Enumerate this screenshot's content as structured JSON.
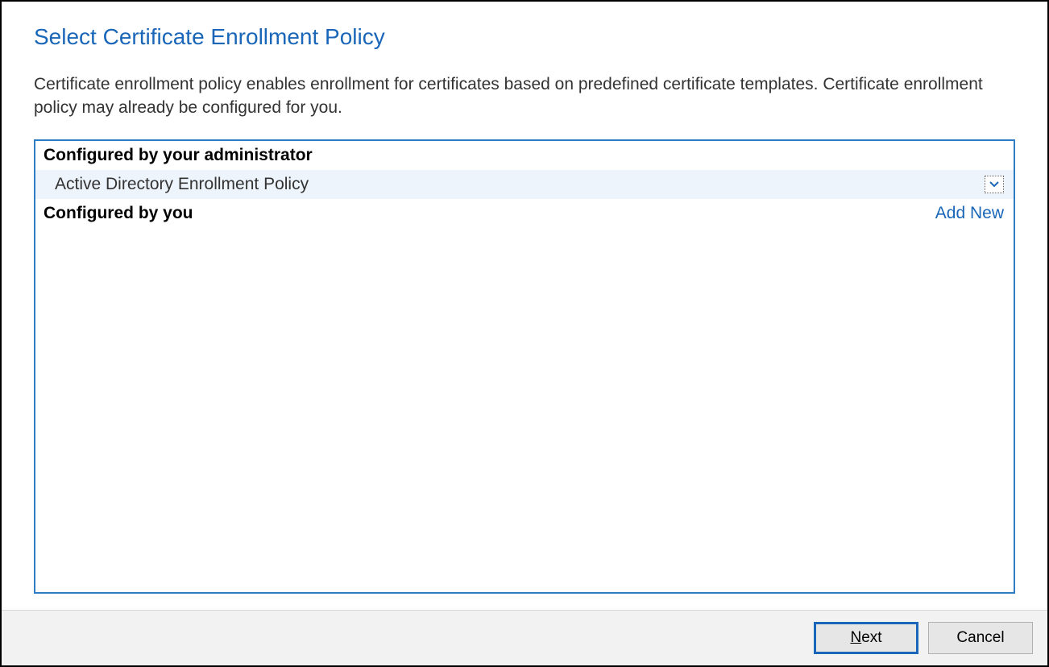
{
  "header": {
    "title": "Select Certificate Enrollment Policy"
  },
  "description": "Certificate enrollment policy enables enrollment for certificates based on predefined certificate templates. Certificate enrollment policy may already be configured for you.",
  "panel": {
    "admin_section_label": "Configured by your administrator",
    "admin_policies": [
      {
        "label": "Active Directory Enrollment Policy"
      }
    ],
    "user_section_label": "Configured by you",
    "add_new_label": "Add New"
  },
  "footer": {
    "next_mnemonic": "N",
    "next_rest": "ext",
    "cancel_label": "Cancel"
  }
}
